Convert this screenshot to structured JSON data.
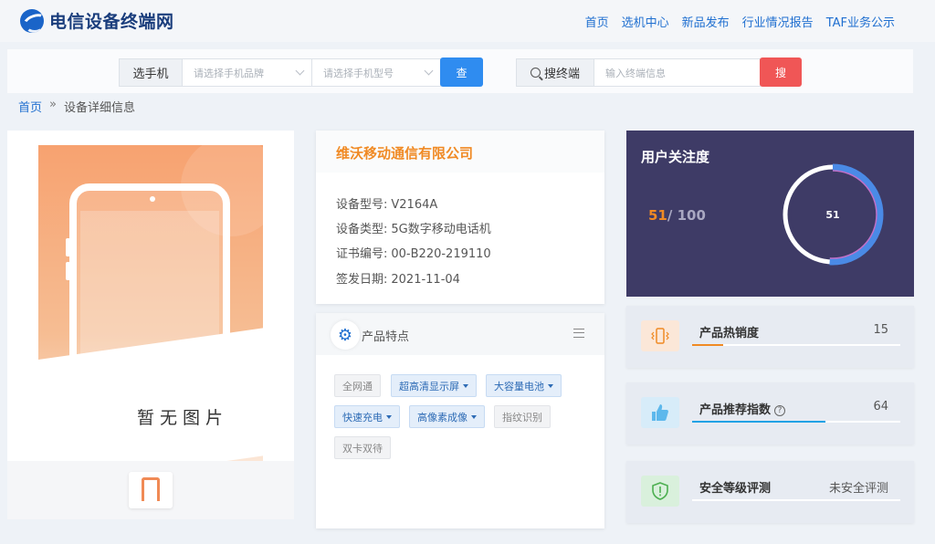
{
  "header": {
    "logo_text": "电信设备终端网",
    "nav": [
      "首页",
      "选机中心",
      "新品发布",
      "行业情况报告",
      "TAF业务公示"
    ]
  },
  "search": {
    "phone_label": "选手机",
    "brand_placeholder": "请选择手机品牌",
    "model_placeholder": "请选择手机型号",
    "query_button": "查",
    "terminal_label": "搜终端",
    "terminal_placeholder": "输入终端信息",
    "search_button": "搜"
  },
  "breadcrumb": {
    "home": "首页",
    "sep": "»",
    "current": "设备详细信息"
  },
  "image_panel": {
    "no_image_text": "暂无图片"
  },
  "device": {
    "company": "维沃移动通信有限公司",
    "rows": [
      {
        "key": "设备型号:",
        "value": "V2164A"
      },
      {
        "key": "设备类型:",
        "value": "5G数字移动电话机"
      },
      {
        "key": "证书编号:",
        "value": "00-B220-219110"
      },
      {
        "key": "签发日期:",
        "value": "2021-11-04"
      }
    ]
  },
  "features": {
    "title": "产品特点",
    "tags": [
      {
        "label": "全网通",
        "style": "grey",
        "dropdown": false
      },
      {
        "label": "超高清显示屏",
        "style": "blue",
        "dropdown": true
      },
      {
        "label": "大容量电池",
        "style": "blue",
        "dropdown": true
      },
      {
        "label": "快速充电",
        "style": "blue",
        "dropdown": true
      },
      {
        "label": "高像素成像",
        "style": "blue",
        "dropdown": true
      },
      {
        "label": "指纹识别",
        "style": "grey",
        "dropdown": false
      },
      {
        "label": "双卡双待",
        "style": "grey",
        "dropdown": false
      }
    ]
  },
  "attention": {
    "title": "用户关注度",
    "score": "51",
    "max": "/ 100",
    "ring_label": "51",
    "percent": 51
  },
  "stats": [
    {
      "label": "产品热销度",
      "value": "15",
      "icon": "vibrating-phone-icon",
      "fill": 15,
      "color": "#f08a24"
    },
    {
      "label": "产品推荐指数",
      "value": "64",
      "icon": "thumbs-up-icon",
      "fill": 64,
      "color": "#1ea2e4",
      "help": "?"
    },
    {
      "label": "安全等级评测",
      "value": "未安全评测",
      "icon": "shield-alert-icon",
      "fill": 0,
      "color": "#4caf50"
    }
  ],
  "colors": {
    "accent": "#1f6fd0",
    "orange": "#f08a24",
    "danger": "#f05656",
    "dark_panel": "#3e3b66"
  }
}
